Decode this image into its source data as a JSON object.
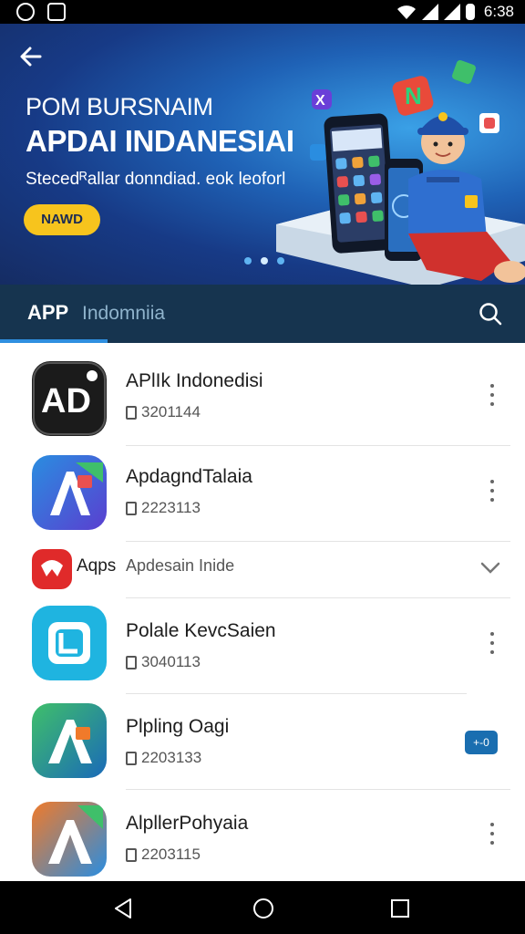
{
  "status_bar": {
    "time": "6:38"
  },
  "hero": {
    "title_line1": "POM BURSNAIM",
    "title_line2": "APDAI INDANESIAI",
    "subtitle": "Stecedᴿallar donndiad. eok leoforl",
    "cta_label": "NAWD",
    "carousel_pages": 3,
    "carousel_active": 2
  },
  "tabs": {
    "active_label": "APP",
    "secondary_label": "Indomniia"
  },
  "apps": [
    {
      "name": "APlIk Indonedisi",
      "meta": "3201144"
    },
    {
      "name": "Apdagnd​Talaia",
      "meta": "2223113"
    },
    {
      "name": "Apdesain Inide",
      "badge": "Aqps"
    },
    {
      "name": "Polale KevcSaien",
      "meta": "3040113"
    },
    {
      "name": "Plpling Oagi",
      "meta": "2203133",
      "chip": "+-0"
    },
    {
      "name": "AlpllerPohyaia",
      "meta": "2203115"
    }
  ],
  "colors": {
    "accent": "#2f8fe0",
    "tab_bar": "#16344f",
    "cta": "#f7c41d"
  }
}
